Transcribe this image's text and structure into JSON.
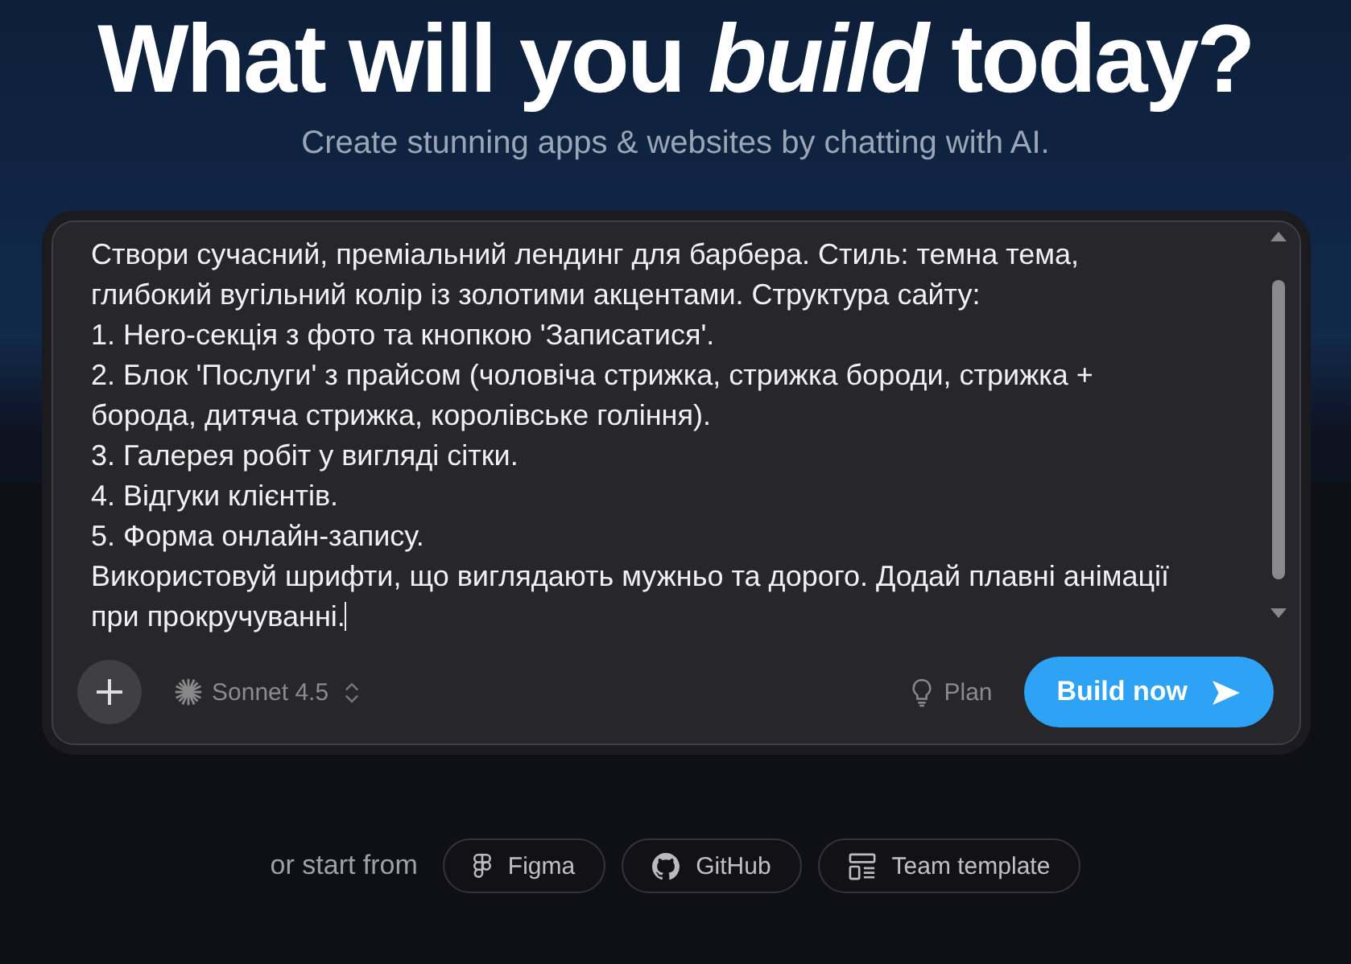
{
  "hero": {
    "title": "What will you *build* today?",
    "subtitle": "Create stunning apps & websites by chatting with AI."
  },
  "prompt": {
    "value": "Створи сучасний, преміальний лендинг для барбера. Стиль: темна тема, глибокий вугільний колір із золотими акцентами. Структура сайту:\n1. Hero-секція з фото та кнопкою 'Записатися'.\n2. Блок 'Послуги' з прайсом (чоловіча стрижка, стрижка бороди, стрижка + борода, дитяча стрижка, королівське гоління).\n3. Галерея робіт у вигляді сітки.\n4. Відгуки клієнтів.\n5. Форма онлайн-запису.\nВикористовуй шрифти, що виглядають мужньо та дорого. Додай плавні анімації при прокручуванні."
  },
  "toolbar": {
    "model": "Sonnet 4.5",
    "plan": "Plan",
    "build": "Build now"
  },
  "start_from": {
    "label": "or start from",
    "sources": [
      {
        "kind": "figma",
        "label": "Figma"
      },
      {
        "kind": "github",
        "label": "GitHub"
      },
      {
        "kind": "template",
        "label": "Team template"
      }
    ]
  }
}
